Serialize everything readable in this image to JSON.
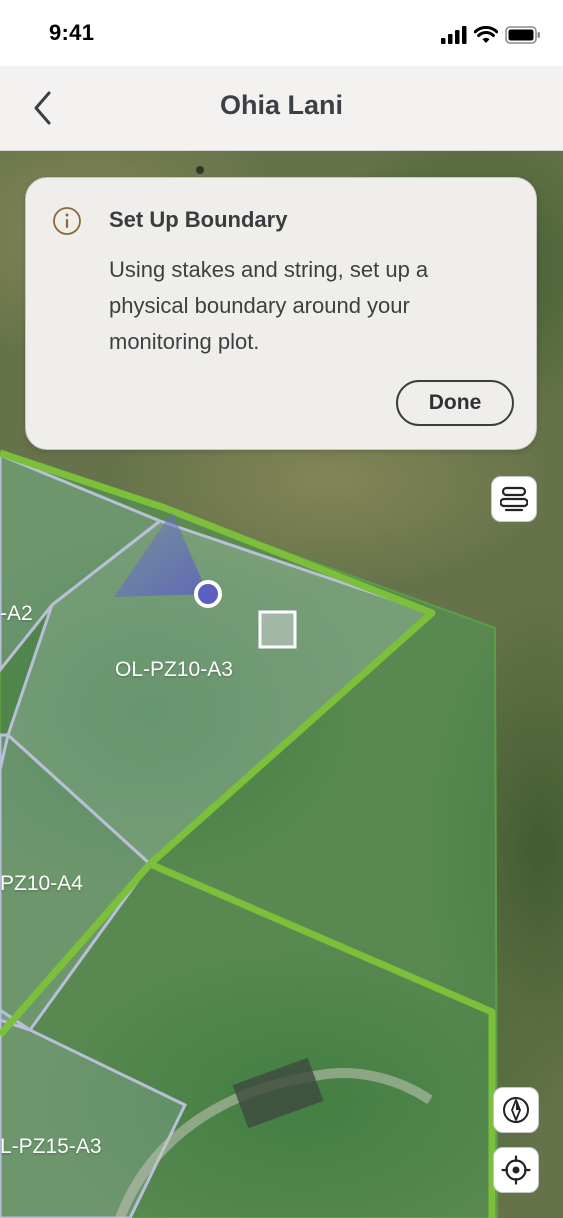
{
  "status_bar": {
    "time": "9:41",
    "icons": [
      "signal-icon",
      "wifi-icon",
      "battery-icon"
    ]
  },
  "nav": {
    "back_icon": "chevron-left-icon",
    "title": "Ohia Lani"
  },
  "info_card": {
    "icon": "info-icon",
    "title": "Set Up Boundary",
    "body": "Using stakes and string, set up a physical boundary around your monitoring plot.",
    "done_label": "Done"
  },
  "map": {
    "plots": [
      {
        "id": "a2",
        "label": "-A2"
      },
      {
        "id": "a3",
        "label": "OL-PZ10-A3"
      },
      {
        "id": "a4",
        "label": "PZ10-A4"
      },
      {
        "id": "a15",
        "label": "L-PZ15-A3"
      }
    ],
    "controls": [
      {
        "id": "layers",
        "icon": "layers-icon"
      },
      {
        "id": "compass",
        "icon": "compass-icon"
      },
      {
        "id": "locate",
        "icon": "locate-icon"
      }
    ],
    "colors": {
      "boundary": "#7bbf3a",
      "plot_outline": "#b8c0d8",
      "user_location": "#5b60c0",
      "zone_fill": "#4f9a55"
    }
  }
}
